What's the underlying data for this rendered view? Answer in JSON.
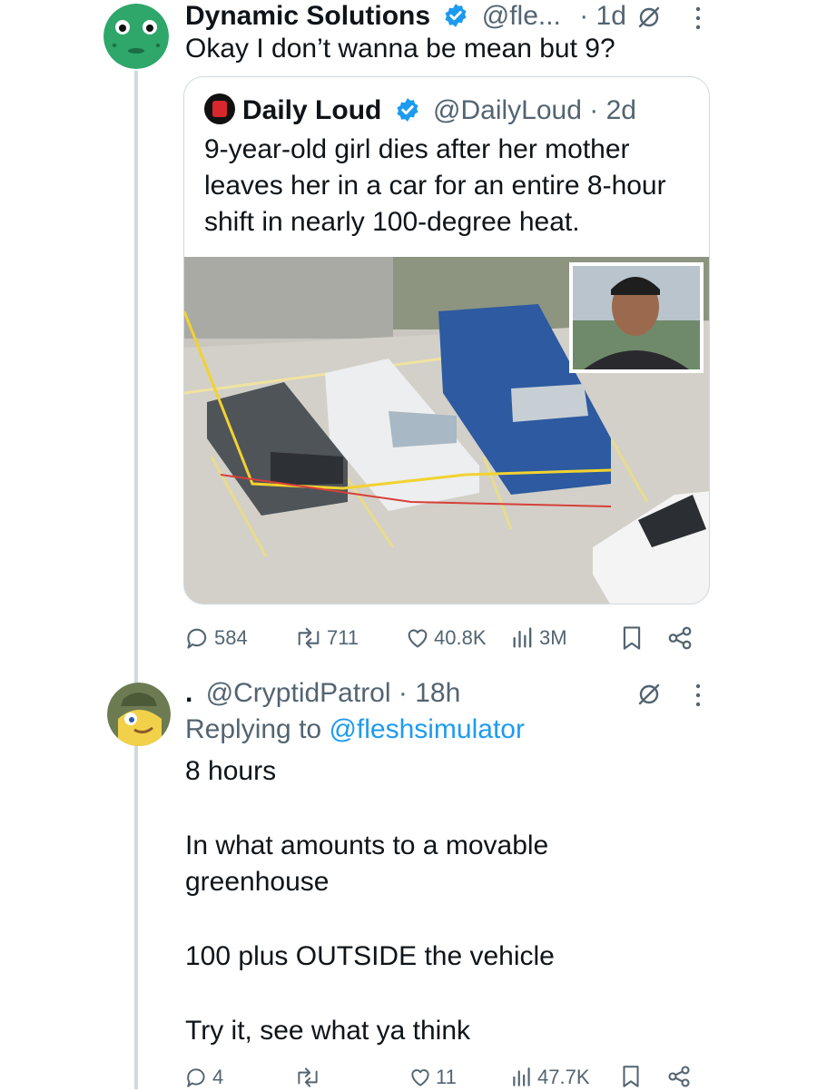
{
  "thread": {
    "tweet1": {
      "display_name": "Dynamic Solutions",
      "handle": "@fle...",
      "time": "· 1d",
      "text": "Okay I don’t wanna be mean but 9?"
    },
    "quote": {
      "display_name": "Daily Loud",
      "handle_time": "@DailyLoud · 2d",
      "text": "9-year-old girl dies after her mother leaves her in a car for an entire 8-hour shift in nearly 100-degree heat."
    },
    "actions1": {
      "replies": "584",
      "reposts": "711",
      "likes": "40.8K",
      "views": "3M"
    },
    "tweet2": {
      "display_name": ".",
      "handle_time": "@CryptidPatrol · 18h",
      "replying_prefix": "Replying to",
      "replying_handle": "@fleshsimulator",
      "lines": [
        "8 hours",
        "In what amounts to a movable",
        "greenhouse",
        "100 plus OUTSIDE the vehicle",
        "Try it, see what ya think"
      ]
    },
    "actions2": {
      "replies": "4",
      "reposts": "",
      "likes": "11",
      "views": "47.7K"
    }
  },
  "colors": {
    "accent": "#1d9bf0",
    "muted": "#536471",
    "text": "#0f1419",
    "border": "#cfd9de"
  },
  "icons": [
    "verified-badge-icon",
    "grok-slash-icon",
    "more-icon",
    "reply-icon",
    "repost-icon",
    "like-icon",
    "views-icon",
    "bookmark-icon",
    "share-icon"
  ]
}
